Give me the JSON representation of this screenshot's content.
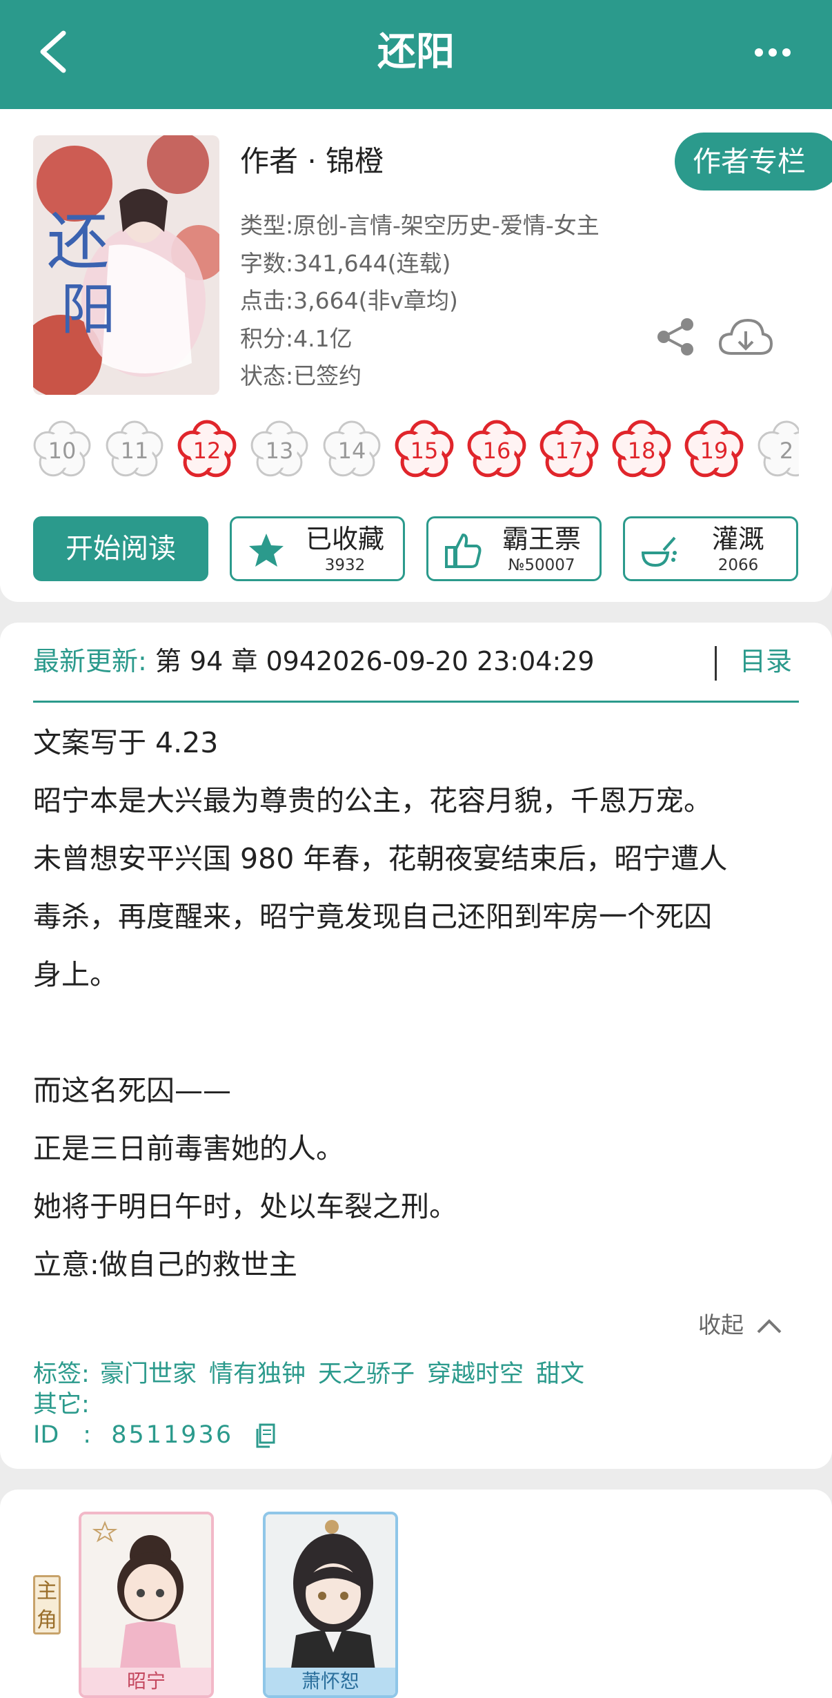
{
  "header": {
    "title": "还阳",
    "back_icon": "back-arrow-icon",
    "more_icon": "more-dots-icon"
  },
  "book": {
    "author": "作者 · 锦橙",
    "author_column_label": "作者专栏",
    "genre": "类型:原创-言情-架空历史-爱情-女主",
    "word_count": "字数:341,644(连载)",
    "clicks": "点击:3,664(非v章均)",
    "score": "积分:4.1亿",
    "status": "状态:已签约",
    "cover_text": "还阳"
  },
  "flower_levels": [
    {
      "label": "10",
      "active": false
    },
    {
      "label": "11",
      "active": false
    },
    {
      "label": "12",
      "active": true
    },
    {
      "label": "13",
      "active": false
    },
    {
      "label": "14",
      "active": false
    },
    {
      "label": "15",
      "active": true
    },
    {
      "label": "16",
      "active": true
    },
    {
      "label": "17",
      "active": true
    },
    {
      "label": "18",
      "active": true
    },
    {
      "label": "19",
      "active": true
    },
    {
      "label": "2",
      "active": false
    }
  ],
  "actions": {
    "start_reading": "开始阅读",
    "collect": {
      "label": "已收藏",
      "count": "3932"
    },
    "ticket": {
      "label": "霸王票",
      "count": "№50007"
    },
    "water": {
      "label": "灌溉",
      "count": "2066"
    }
  },
  "latest": {
    "label": "最新更新:",
    "value": "第 94 章 0942026-09-20 23:04:29",
    "toc_label": "目录"
  },
  "description": [
    "文案写于 4.23",
    "昭宁本是大兴最为尊贵的公主，花容月貌，千恩万宠。",
    "未曾想安平兴国 980 年春，花朝夜宴结束后，昭宁遭人",
    "毒杀，再度醒来，昭宁竟发现自己还阳到牢房一个死囚",
    "身上。",
    "",
    "而这名死囚——",
    "正是三日前毒害她的人。",
    "她将于明日午时，处以车裂之刑。",
    "立意:做自己的救世主"
  ],
  "collapse_label": "收起",
  "tags": {
    "label": "标签:",
    "items": [
      "豪门世家",
      "情有独钟",
      "天之骄子",
      "穿越时空",
      "甜文"
    ],
    "other_label": "其它:",
    "id_label": "ID　:",
    "id_value": "8511936"
  },
  "characters": {
    "role_label": "主角",
    "list": [
      {
        "name": "昭宁",
        "frame_color": "#f2b8c8",
        "name_bg": "#f9d9e2",
        "name_color": "#c4485f"
      },
      {
        "name": "萧怀恕",
        "frame_color": "#8fc6e8",
        "name_bg": "#b7dcf2",
        "name_color": "#2b6f9c"
      }
    ]
  },
  "colors": {
    "accent": "#2b9a8c",
    "flower_red": "#e0252b",
    "flower_grey": "#c8c8c8"
  }
}
